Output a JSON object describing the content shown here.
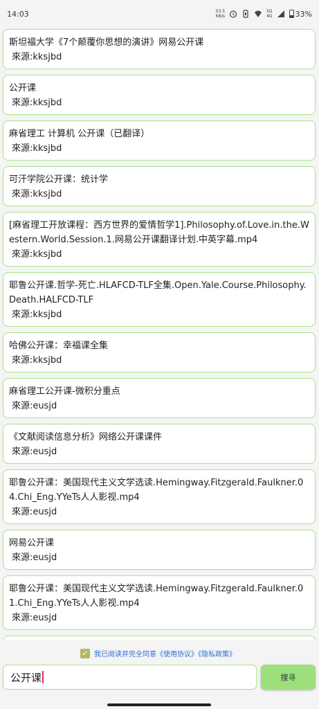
{
  "status_bar": {
    "time": "14:03",
    "speed_value": "53.5",
    "speed_unit": "KB/s",
    "network": "5G",
    "network_sub": "4G",
    "battery": "33%"
  },
  "results": [
    {
      "title": "斯坦福大学《7个颠覆你思想的演讲》网易公开课",
      "source": "來源:kksjbd"
    },
    {
      "title": "公开课",
      "source": "來源:kksjbd"
    },
    {
      "title": "麻省理工  计算机 公开课（已翻译）",
      "source": "來源:kksjbd"
    },
    {
      "title": "可汗学院公开课：统计学",
      "source": "來源:kksjbd"
    },
    {
      "title": "[麻省理工开放课程：西方世界的爱情哲学1].Philosophy.of.Love.in.the.Western.World.Session.1.网易公开课翻译计划.中英字幕.mp4",
      "source": "來源:kksjbd"
    },
    {
      "title": "耶鲁公开课.哲学-死亡.HLAFCD-TLF全集.Open.Yale.Course.Philosophy.Death.HALFCD-TLF",
      "source": "來源:kksjbd"
    },
    {
      "title": "哈佛公开课：幸福课全集",
      "source": "來源:kksjbd"
    },
    {
      "title": "麻省理工公开课-微积分重点",
      "source": "來源:eusjd"
    },
    {
      "title": "《文献阅读信息分析》网络公开课课件",
      "source": "來源:eusjd"
    },
    {
      "title": "耶鲁公开课：美国现代主义文学选读.Hemingway.Fitzgerald.Faulkner.04.Chi_Eng.YYeTs人人影视.mp4",
      "source": "來源:eusjd"
    },
    {
      "title": "网易公开课",
      "source": "來源:eusjd"
    },
    {
      "title": "耶鲁公开课：美国现代主义文学选读.Hemingway.Fitzgerald.Faulkner.01.Chi_Eng.YYeTs人人影视.mp4",
      "source": "來源:eusjd"
    }
  ],
  "agreement": {
    "checked": true,
    "check_mark": "✓",
    "text": "我已阅读并完全同意《使用协议》《隐私政策》"
  },
  "search": {
    "value": "公开课",
    "button_label": "搜寻"
  },
  "colors": {
    "card_border": "#a8e28a",
    "button": "#9ddf7d",
    "link": "#2f6bd8"
  }
}
